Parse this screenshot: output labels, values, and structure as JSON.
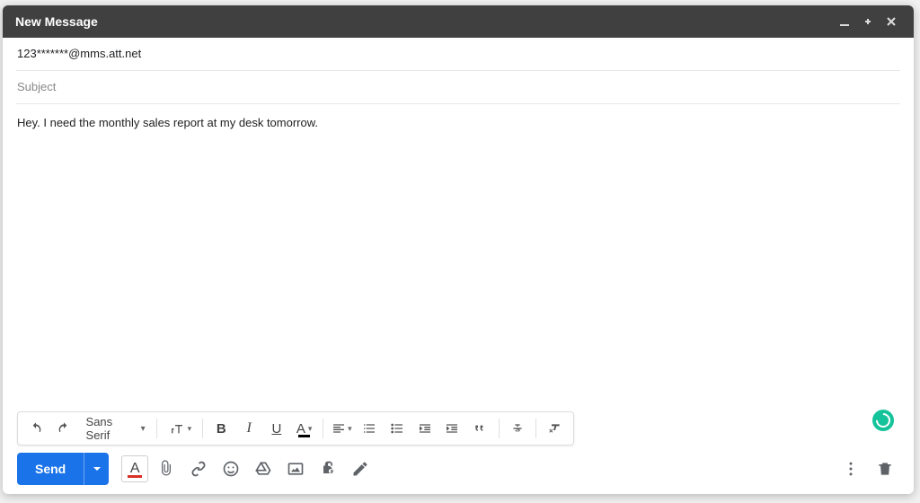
{
  "window": {
    "title": "New Message"
  },
  "fields": {
    "to_value": "123*******@mms.att.net",
    "subject_placeholder": "Subject",
    "subject_value": ""
  },
  "body": {
    "text": "Hey. I need the monthly sales report at my desk tomorrow."
  },
  "format_toolbar": {
    "font_family": "Sans Serif"
  },
  "actions": {
    "send_label": "Send"
  },
  "colors": {
    "primary": "#1a73e8",
    "text_color_accent": "#d93025",
    "grammarly": "#15c39a"
  }
}
